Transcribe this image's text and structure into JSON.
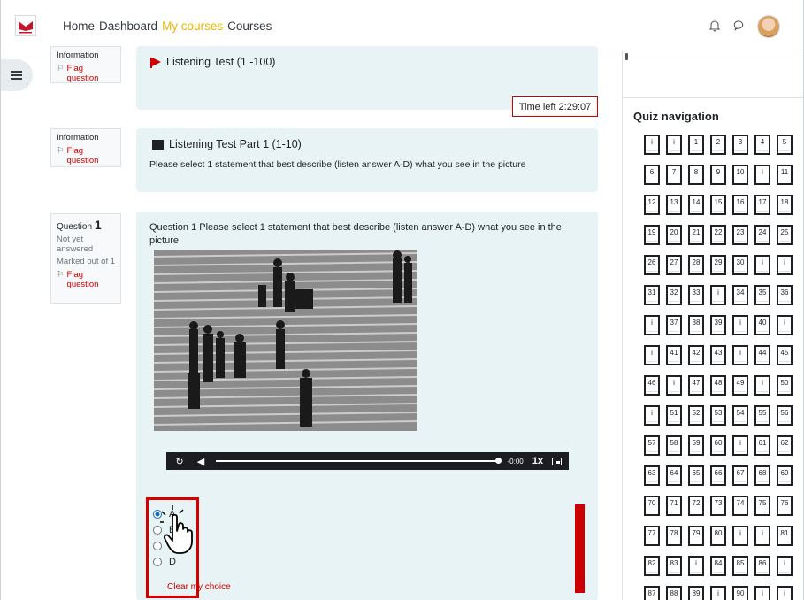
{
  "nav": {
    "links": [
      "Home",
      "Dashboard",
      "My courses",
      "Courses"
    ],
    "active": "My courses"
  },
  "info1": {
    "label": "Information",
    "flag": "Flag question"
  },
  "info2": {
    "label": "Information",
    "flag": "Flag question"
  },
  "question": {
    "label": "Question",
    "number": "1",
    "status": "Not yet answered",
    "marked": "Marked out of 1",
    "flag": "Flag question"
  },
  "section1": {
    "title": "Listening Test (1 -100)"
  },
  "timer": "Time left 2:29:07",
  "section2": {
    "title": "Listening Test  Part 1 (1-10)",
    "text": "Please select 1 statement that best describe (listen answer A-D) what you see in the picture"
  },
  "q1": {
    "text": "Question 1 Please select 1 statement that best describe (listen answer A-D) what you see in the picture",
    "audio": {
      "time": "-0:00",
      "speed": "1x"
    },
    "options": [
      "A",
      "B",
      "C",
      "D"
    ],
    "selected": "A",
    "clear": "Clear my choice"
  },
  "quiz_nav": {
    "title": "Quiz navigation",
    "items": [
      "i",
      "i",
      "1",
      "2",
      "3",
      "4",
      "5",
      "6",
      "7",
      "8",
      "9",
      "10",
      "i",
      "11",
      "12",
      "13",
      "14",
      "15",
      "16",
      "17",
      "18",
      "19",
      "20",
      "21",
      "22",
      "23",
      "24",
      "25",
      "26",
      "27",
      "28",
      "29",
      "30",
      "i",
      "i",
      "31",
      "32",
      "33",
      "i",
      "34",
      "35",
      "36",
      "i",
      "37",
      "38",
      "39",
      "i",
      "40",
      "i",
      "i",
      "41",
      "42",
      "43",
      "i",
      "44",
      "45",
      "46",
      "i",
      "47",
      "48",
      "49",
      "i",
      "50",
      "i",
      "51",
      "52",
      "53",
      "54",
      "55",
      "56",
      "57",
      "58",
      "59",
      "60",
      "i",
      "61",
      "62",
      "63",
      "64",
      "65",
      "66",
      "67",
      "68",
      "69",
      "70",
      "71",
      "72",
      "73",
      "74",
      "75",
      "76",
      "77",
      "78",
      "79",
      "80",
      "i",
      "i",
      "81",
      "82",
      "83",
      "i",
      "84",
      "85",
      "86",
      "i",
      "87",
      "88",
      "89",
      "i",
      "90",
      "i",
      "i"
    ]
  },
  "colors": {
    "accent": "#f0b400",
    "danger": "#cc0000",
    "panel": "#e7f3f5"
  }
}
